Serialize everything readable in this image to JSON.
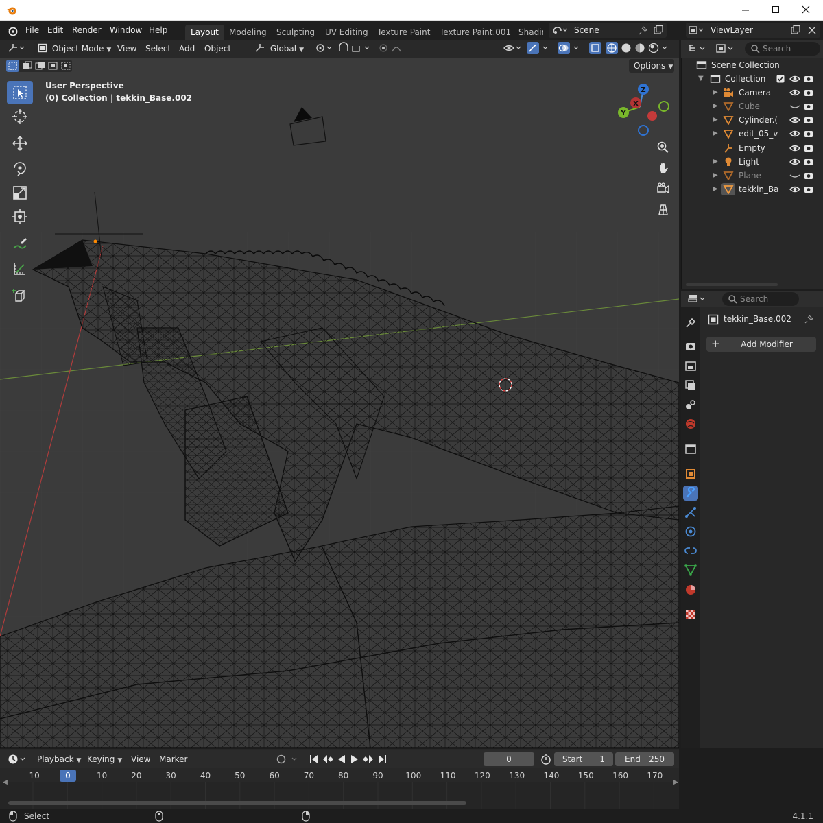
{
  "window": {
    "app_name": "Blender",
    "controls": [
      "minimize",
      "maximize",
      "close"
    ]
  },
  "menubar": {
    "items": [
      "File",
      "Edit",
      "Render",
      "Window",
      "Help"
    ],
    "workspaces": [
      "Layout",
      "Modeling",
      "Sculpting",
      "UV Editing",
      "Texture Paint",
      "Texture Paint.001",
      "Shadir"
    ],
    "active_workspace": "Layout",
    "scene": "Scene",
    "view_layer": "ViewLayer"
  },
  "viewport_header": {
    "mode": "Object Mode",
    "menus": [
      "View",
      "Select",
      "Add",
      "Object"
    ],
    "transform_orientation": "Global",
    "options_label": "Options"
  },
  "viewport": {
    "perspective_label": "User Perspective",
    "collection_label": "(0) Collection | tekkin_Base.002",
    "gizmo_axes": [
      "Z",
      "Y",
      "X"
    ]
  },
  "outliner": {
    "search_placeholder": "Search",
    "root": "Scene Collection",
    "collection": "Collection",
    "items": [
      {
        "name": "Camera",
        "icon": "camera-icon",
        "visible": true
      },
      {
        "name": "Cube",
        "icon": "mesh-icon",
        "visible": false
      },
      {
        "name": "Cylinder.(",
        "icon": "mesh-icon",
        "visible": true
      },
      {
        "name": "edit_05_v",
        "icon": "mesh-icon",
        "visible": true
      },
      {
        "name": "Empty",
        "icon": "empty-icon",
        "visible": true
      },
      {
        "name": "Light",
        "icon": "light-icon",
        "visible": true
      },
      {
        "name": "Plane",
        "icon": "mesh-icon",
        "visible": false
      },
      {
        "name": "tekkin_Ba",
        "icon": "mesh-icon",
        "visible": true
      }
    ]
  },
  "properties": {
    "search_placeholder": "Search",
    "object_name": "tekkin_Base.002",
    "add_modifier_label": "Add Modifier"
  },
  "timeline": {
    "menus": [
      "Playback",
      "Keying",
      "View",
      "Marker"
    ],
    "current_frame": "0",
    "start_label": "Start",
    "start_value": "1",
    "end_label": "End",
    "end_value": "250",
    "ruler": [
      "-10",
      "0",
      "10",
      "20",
      "30",
      "40",
      "50",
      "60",
      "70",
      "80",
      "90",
      "100",
      "110",
      "120",
      "130",
      "140",
      "150",
      "160",
      "170"
    ]
  },
  "statusbar": {
    "left_hint": "Select",
    "version": "4.1.1"
  }
}
